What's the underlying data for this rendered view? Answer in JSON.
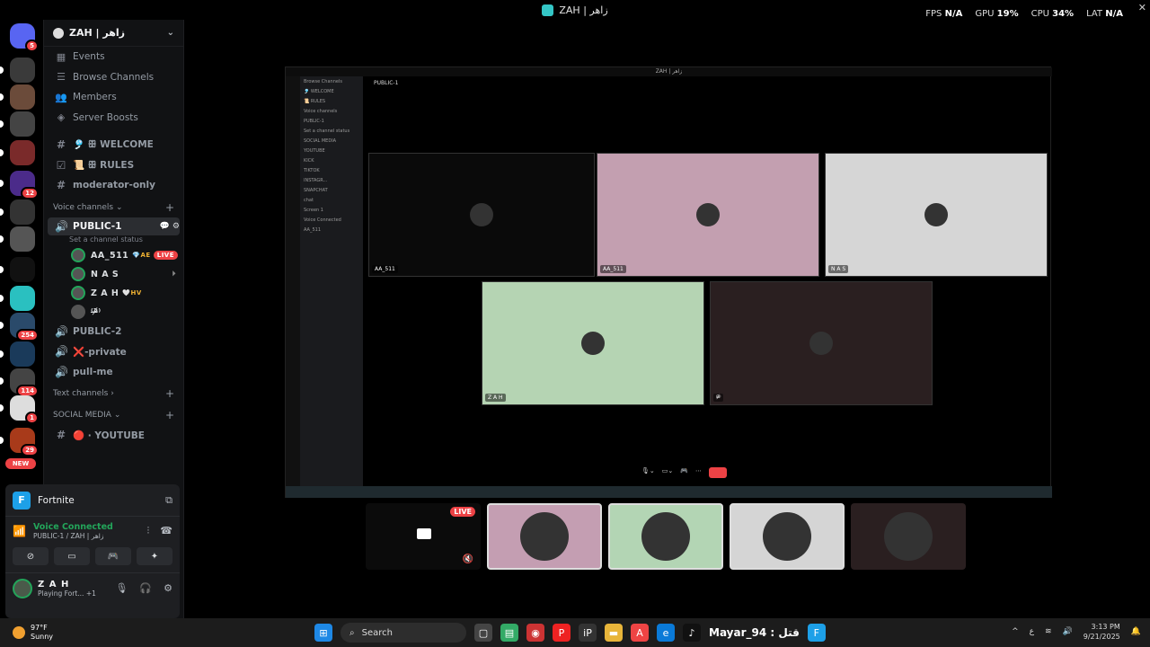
{
  "window": {
    "title": "ZAH | زاهر"
  },
  "hud": {
    "fps_label": "FPS",
    "fps": "N/A",
    "gpu_label": "GPU",
    "gpu": "19%",
    "cpu_label": "CPU",
    "cpu": "34%",
    "lat_label": "LAT",
    "lat": "N/A"
  },
  "rail": [
    {
      "badge": "5",
      "color": "#5865f2"
    },
    {
      "badge": "",
      "color": "#3a3a3a"
    },
    {
      "badge": "",
      "color": "#6b4b3a"
    },
    {
      "badge": "",
      "color": "#444"
    },
    {
      "badge": "",
      "color": "#7a2a2a"
    },
    {
      "badge": "12",
      "color": "#4b2b8a"
    },
    {
      "badge": "",
      "color": "#333"
    },
    {
      "badge": "",
      "color": "#555"
    },
    {
      "badge": "",
      "color": "#111"
    },
    {
      "badge": "",
      "color": "#2ac0c0"
    },
    {
      "badge": "254",
      "color": "#2a4a6a"
    },
    {
      "badge": "",
      "color": "#1a3a5a"
    },
    {
      "badge": "114",
      "color": "#444"
    },
    {
      "badge": "1",
      "color": "#ddd"
    },
    {
      "badge": "29",
      "color": "#a83a1a"
    }
  ],
  "rail_new": "NEW",
  "sidebar": {
    "server_name": "ZAH | زاهر",
    "nav": [
      {
        "label": "Events",
        "icon": "calendar-icon",
        "glyph": "▦"
      },
      {
        "label": "Browse Channels",
        "icon": "browse-icon",
        "glyph": "☰"
      },
      {
        "label": "Members",
        "icon": "members-icon",
        "glyph": "👥"
      },
      {
        "label": "Server Boosts",
        "icon": "boost-icon",
        "glyph": "◈"
      }
    ],
    "text_top": [
      {
        "label": "🎐 ꕥ WELCOME",
        "glyph": "#"
      },
      {
        "label": "📜 ꕥ RULES",
        "glyph": "☑"
      },
      {
        "label": "moderator-only",
        "glyph": "#"
      }
    ],
    "voice_category": "Voice channels",
    "active_channel": "PUBLIC-1",
    "active_status": "Set a channel status",
    "voice_users": [
      {
        "name": "AA_511",
        "tag": "💎AE",
        "live": "LIVE"
      },
      {
        "name": "N A S",
        "tag": "",
        "live": ""
      },
      {
        "name": "Z A H",
        "tag": "🤍HV",
        "live": ""
      },
      {
        "name": "⁽ᵒ̴̶̷᷄⁾",
        "tag": "",
        "live": ""
      }
    ],
    "voice_more": [
      {
        "label": "PUBLIC-2"
      },
      {
        "label": "❌-private"
      },
      {
        "label": "pull-me"
      }
    ],
    "text_category": "Text channels",
    "social_category": "SOCIAL MEDIA",
    "youtube": "🔴 · YOUTUBE"
  },
  "panel": {
    "game": "Fortnite",
    "voice_status": "Voice Connected",
    "voice_channel": "PUBLIC-1 / ZAH | زاهر",
    "user_name": "Z A H",
    "user_status": "Playing Fort... +1"
  },
  "stream": {
    "inner_title": "ZAH | زاهر",
    "inner_channel": "PUBLIC-1",
    "inner_side": [
      "Browse Channels",
      "🎐 WELCOME",
      "📜 RULES",
      "Voice channels",
      "PUBLIC-1",
      "Set a channel status",
      "SOCIAL MEDIA",
      "YOUTUBE",
      "KICK",
      "TIKTOK",
      "INSTAGR...",
      "SNAPCHAT",
      "chat",
      "Screen 1",
      "Voice Connected",
      "AA_511"
    ],
    "tiles": [
      {
        "name": "AA_511",
        "bg": "#0a0a0a"
      },
      {
        "name": "AA_511",
        "bg": "#c39fb0"
      },
      {
        "name": "N A S",
        "bg": "#d6d6d6"
      },
      {
        "name": "Z A H",
        "bg": "#b5d4b3"
      },
      {
        "name": "⁽ᵒ̴̶̷᷄⁾",
        "bg": "#2a1f20"
      }
    ]
  },
  "thumbs": [
    {
      "bg": "#0b0b0b",
      "live": "LIVE"
    },
    {
      "bg": "#c49eb2",
      "live": ""
    },
    {
      "bg": "#b3d5b4",
      "live": ""
    },
    {
      "bg": "#d5d5d5",
      "live": ""
    },
    {
      "bg": "#2a1f20",
      "live": ""
    }
  ],
  "taskbar": {
    "temp": "97°F",
    "weather": "Sunny",
    "search": "Search",
    "app_title": "Mayar_94 : قتل",
    "time": "3:13 PM",
    "date": "9/21/2025",
    "lang": "ع"
  }
}
